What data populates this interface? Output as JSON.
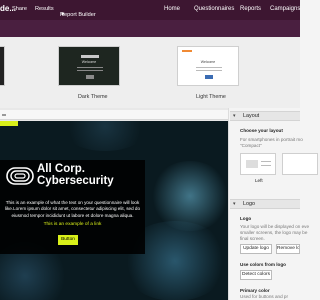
{
  "header": {
    "brand": "de...",
    "nav": [
      "Home",
      "Questionnaires",
      "Reports",
      "Campaigns"
    ]
  },
  "subnav": {
    "items": [
      "Share",
      "Results",
      "Report Builder"
    ]
  },
  "themes": [
    {
      "label": "Dark Theme",
      "preview_title": "Welcome"
    },
    {
      "label": "Light Theme",
      "preview_title": "Welcome"
    }
  ],
  "preview": {
    "logo_line1": "All Corp.",
    "logo_line2": "Cybersecurity",
    "body": "This is an example of what the text on your questionnaire will look like.Lorem ipsum dolor sit amet, consectetur adipiscing elit, sed do eiusmod tempor incididunt ut labore et dolore magna aliqua.",
    "highlight": "This is an example of a link",
    "button": "Button"
  },
  "panel": {
    "layout_title": "Layout",
    "choose_layout": "Choose your layout",
    "layout_desc1": "For smartphones in portrait mo",
    "layout_desc2": "\"Compact\"",
    "layout_option": "Left",
    "logo_title": "Logo",
    "logo_label": "Logo",
    "logo_desc1": "Your logo will be displayed on eve",
    "logo_desc2": "smaller screens, the logo may be",
    "logo_desc3": "final screen.",
    "update_logo": "Update logo",
    "remove_logo": "Remove lo",
    "use_colors": "Use colors from logo",
    "detect_colors": "Detect colors",
    "primary_color": "Primary color",
    "primary_desc": "Used for buttons and pr"
  },
  "colors": {
    "header": "#3d1631",
    "subheader": "#4a1f40",
    "accent": "#d9f01a"
  }
}
